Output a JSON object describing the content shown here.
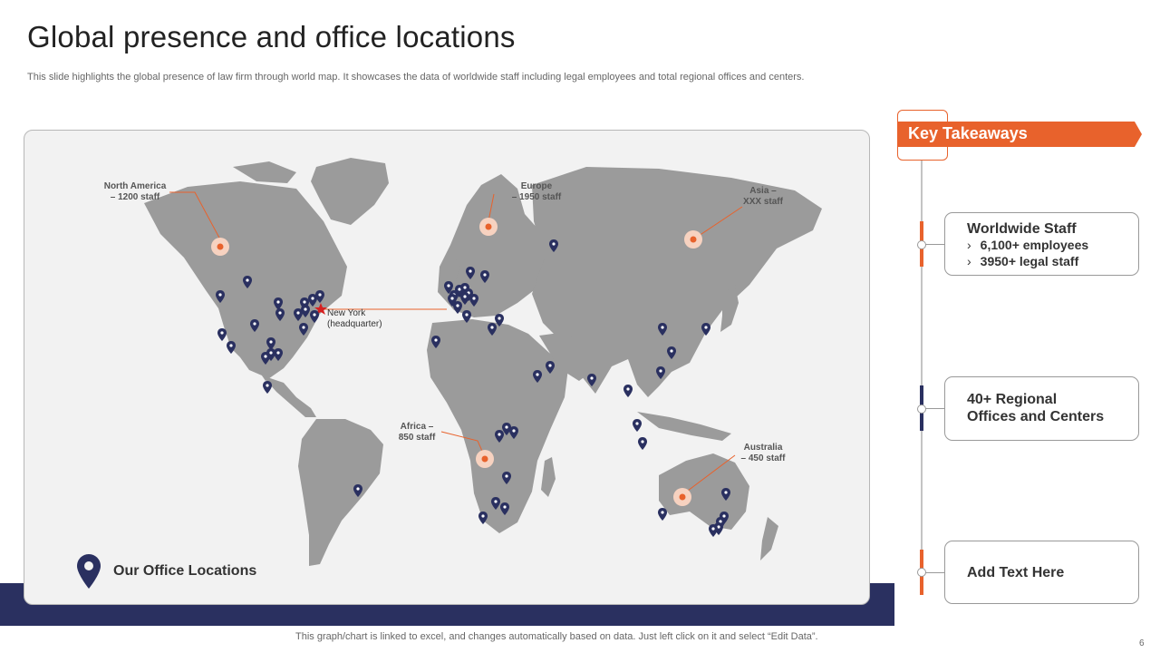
{
  "header": {
    "title": "Global presence and office locations",
    "subtitle": "This slide highlights the global presence of law firm through world map. It showcases the data of worldwide staff including legal employees and total regional offices and centers."
  },
  "map": {
    "regions": [
      {
        "name": "North America – 1200 staff",
        "label": "North America\n– 1200 staff"
      },
      {
        "name": "Europe – 1950 staff",
        "label": "Europe\n– 1950 staff"
      },
      {
        "name": "Asia – XXX staff",
        "label": "Asia –\nXXX staff"
      },
      {
        "name": "Africa – 850 staff",
        "label": "Africa –\n850 staff"
      },
      {
        "name": "Australia – 450 staff",
        "label": "Australia\n– 450 staff"
      }
    ],
    "headquarter": {
      "label": "New York\n(headquarter)"
    },
    "legend": {
      "label": "Our Office Locations"
    },
    "colors": {
      "land": "#9b9b9b",
      "pin": "#2a3060",
      "marker": "#e8622c",
      "star": "#d62020"
    }
  },
  "key_takeaways": {
    "heading": "Key Takeaways",
    "boxes": [
      {
        "title": "Worldwide Staff",
        "items": [
          "6,100+ employees",
          "3950+ legal staff"
        ]
      },
      {
        "title": "40+ Regional\nOffices and Centers",
        "items": []
      },
      {
        "title": "Add Text Here",
        "items": []
      }
    ],
    "accent": "#e8622c",
    "navy": "#2a3060"
  },
  "footer": {
    "note": "This graph/chart is linked to excel,  and changes automatically based on data. Just left click on it and select “Edit Data”.",
    "page_number": "6"
  }
}
